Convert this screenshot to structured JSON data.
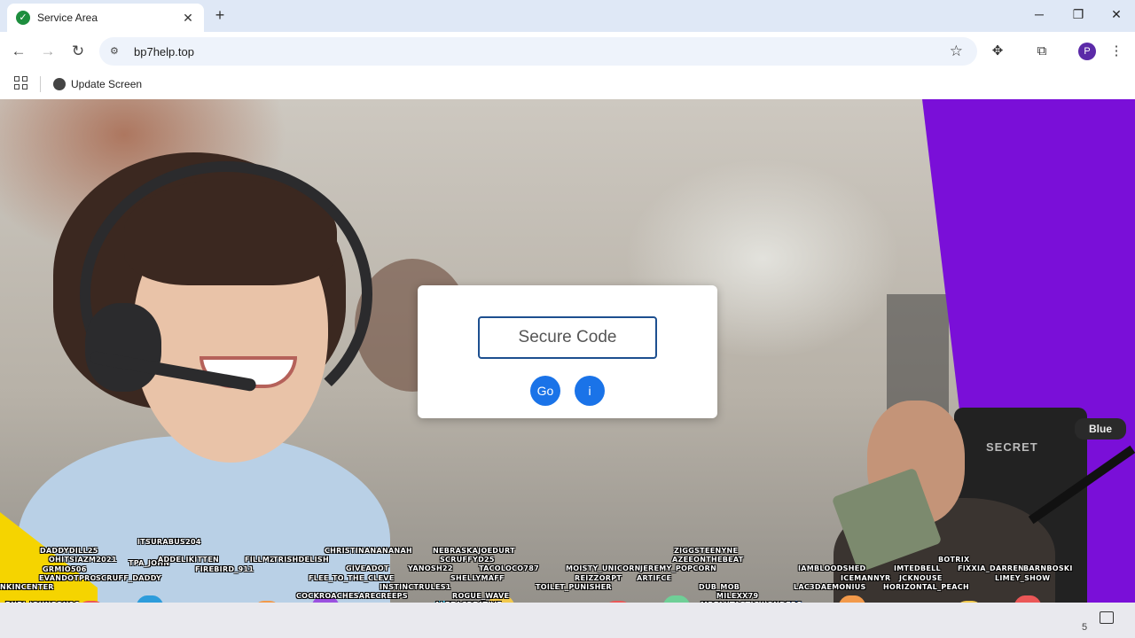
{
  "browser": {
    "tab_title": "Service Area",
    "new_tab_label": "+",
    "url": "bp7help.top",
    "avatar_letter": "P",
    "bookmark_label": "Update Screen"
  },
  "page": {
    "code_placeholder": "Secure Code",
    "go_label": "Go",
    "info_label": "i"
  },
  "overlay": {
    "chair_logo": "SECRET",
    "mic_brand": "Blue",
    "taskbar_fragment": "5",
    "chat_names": [
      "ITSURABUS204",
      "DADDYDILL25",
      "OHITSIAZM2021",
      "TPA_JOHN",
      "ADDELIKITTEN",
      "FIREBIRD_911",
      "GRMIO506",
      "EVANDOTPRO",
      "SCRUFF_DADDY",
      "NKINCENTER",
      "BURI_JOHNSON96",
      "FILLMZ",
      "TRISHDELISH",
      "CHRISTINANANANAH",
      "GIVEADOT",
      "FLEE_TO_THE_CLEVE",
      "INSTINCTRULES1",
      "COCKROACHESARECREEPS",
      "NEBRASKAJOEDURT",
      "SCRUFFYD25",
      "YANOSH22",
      "SHELLYMAFF",
      "TACOLOCO787",
      "ROGUE_WAVE",
      "ALPEACREATIVE",
      "MOISTY_UNICORNS",
      "JEREMY_POPCORN",
      "REIZZORPT",
      "ARTIFCE",
      "TOILET_PUNISHER",
      "ZIGGSTEENYNE",
      "AZEEONTHEBEAT",
      "DUB_MOB",
      "MILEXX79",
      "MRFANTASTICWONDERS",
      "IAMBLOODSHED",
      "ICEMANNYR",
      "LAC3DAEMONIUS",
      "IMTEDBELL",
      "JCKNOUSE",
      "HORIZONTAL_PEACH",
      "BOTRIX",
      "FIXXIA_DARREN",
      "BARNBOSKI",
      "LIMEY_SHOW"
    ]
  }
}
